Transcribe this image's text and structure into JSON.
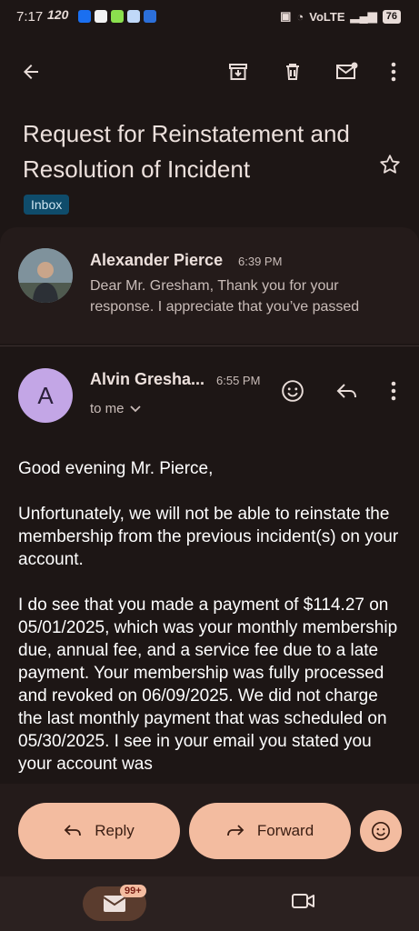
{
  "status_bar": {
    "time": "7:17",
    "network_rate": "120",
    "right_text": "VoLTE",
    "battery": "76"
  },
  "email": {
    "subject": "Request for Reinstatement and Resolution of Incident",
    "label": "Inbox"
  },
  "messages": [
    {
      "sender": "Alexander Pierce",
      "time": "6:39 PM",
      "snippet": "Dear Mr. Gresham, Thank you for your response. I appreciate that you’ve passed"
    },
    {
      "sender": "Alvin Gresha...",
      "avatar_letter": "A",
      "time": "6:55 PM",
      "recipient": "to me",
      "body": [
        "Good evening Mr. Pierce,",
        "Unfortunately, we will not be able to reinstate the membership from the previous incident(s) on your account.",
        "I do see that you made a payment of $114.27 on 05/01/2025, which was your monthly membership due, annual fee, and a service fee due to a late payment. Your membership was fully processed and revoked on 06/09/2025. We did not charge the last monthly payment that was scheduled on 05/30/2025. I see in your email you stated you your account was"
      ]
    }
  ],
  "actions": {
    "reply": "Reply",
    "forward": "Forward"
  },
  "nav": {
    "unread_count": "99+"
  },
  "colors": {
    "background": "#1d1615",
    "accent_pill": "#f3bca0",
    "inbox_badge": "#0f4c6b",
    "avatar_a": "#c3a6e6"
  }
}
